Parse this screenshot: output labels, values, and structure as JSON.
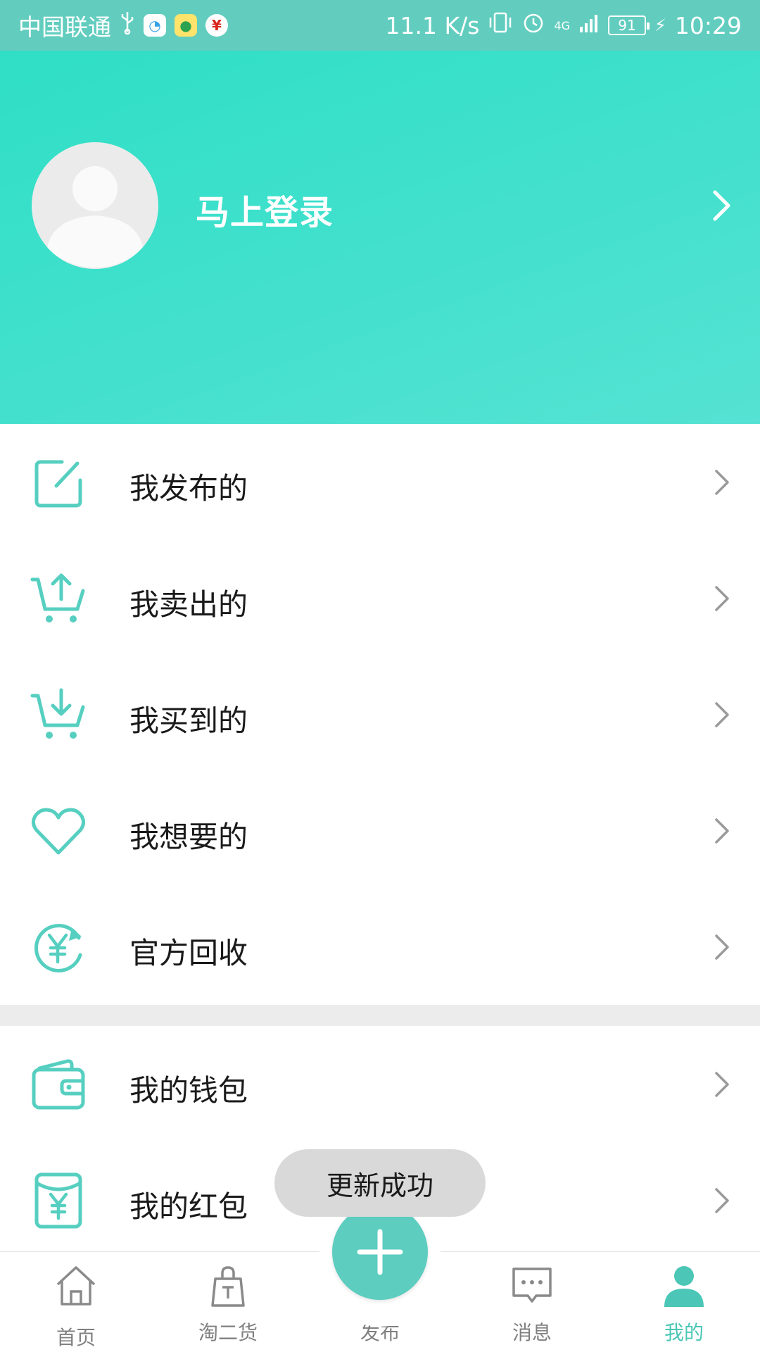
{
  "status_bar": {
    "carrier": "中国联通",
    "net_speed": "11.1 K/s",
    "network": "4G",
    "battery": "91",
    "time": "10:29",
    "icons": [
      "usb-icon",
      "chat-app-icon",
      "qq-app-icon",
      "yen-app-icon",
      "vibrate-icon",
      "alarm-icon",
      "signal-icon",
      "battery-icon",
      "charging-icon"
    ]
  },
  "header": {
    "login_label": "马上登录",
    "colors": {
      "gradient_start": "#2fdfc5",
      "gradient_end": "#55e2d3"
    }
  },
  "menu": {
    "group1": [
      {
        "label": "我发布的",
        "icon": "edit-icon"
      },
      {
        "label": "我卖出的",
        "icon": "cart-upload-icon"
      },
      {
        "label": "我买到的",
        "icon": "cart-download-icon"
      },
      {
        "label": "我想要的",
        "icon": "heart-icon"
      },
      {
        "label": "官方回收",
        "icon": "recycle-yen-icon"
      }
    ],
    "group2": [
      {
        "label": "我的钱包",
        "icon": "wallet-icon"
      },
      {
        "label": "我的红包",
        "icon": "red-packet-icon"
      }
    ]
  },
  "toast": {
    "text": "更新成功"
  },
  "tab_bar": {
    "tabs": [
      {
        "label": "首页",
        "icon": "home-icon",
        "active": false
      },
      {
        "label": "淘二货",
        "icon": "shopping-bag-icon",
        "active": false
      },
      {
        "label": "发布",
        "icon": "plus-icon",
        "active": false
      },
      {
        "label": "消息",
        "icon": "message-icon",
        "active": false
      },
      {
        "label": "我的",
        "icon": "user-icon",
        "active": true
      }
    ]
  },
  "colors": {
    "accent": "#4cc6b6",
    "icon_teal": "#56cfc0",
    "chevron": "#9a9a9a",
    "text": "#1a1a1a",
    "tab_inactive": "#808080"
  }
}
